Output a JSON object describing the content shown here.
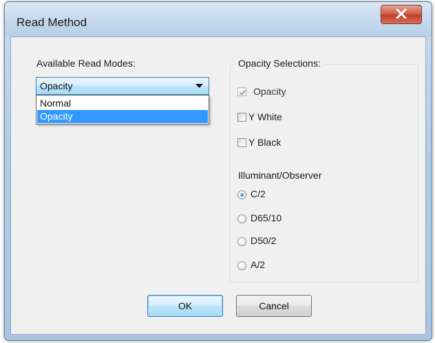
{
  "window": {
    "title": "Read Method"
  },
  "read_modes": {
    "label": "Available Read Modes:",
    "selected": "Opacity",
    "options": [
      "Normal",
      "Opacity"
    ],
    "highlighted_index": 1
  },
  "opacity_selections": {
    "caption": "Opacity Selections:",
    "checkboxes": [
      {
        "label": "Opacity",
        "checked": true,
        "disabled": true
      },
      {
        "label": "Y White",
        "checked": false,
        "disabled": false
      },
      {
        "label": "Y Black",
        "checked": false,
        "disabled": false
      }
    ],
    "illuminant_label": "Illuminant/Observer",
    "radios": [
      {
        "label": "C/2",
        "selected": true
      },
      {
        "label": "D65/10",
        "selected": false
      },
      {
        "label": "D50/2",
        "selected": false
      },
      {
        "label": "A/2",
        "selected": false
      }
    ]
  },
  "buttons": {
    "ok": "OK",
    "cancel": "Cancel"
  },
  "colors": {
    "selection_highlight": "#3399ff",
    "close_button": "#c7452e",
    "focus_blue": "#3c7fb1"
  },
  "icons": {
    "close": "close-icon",
    "dropdown": "chevron-down-icon",
    "check": "check-icon"
  }
}
